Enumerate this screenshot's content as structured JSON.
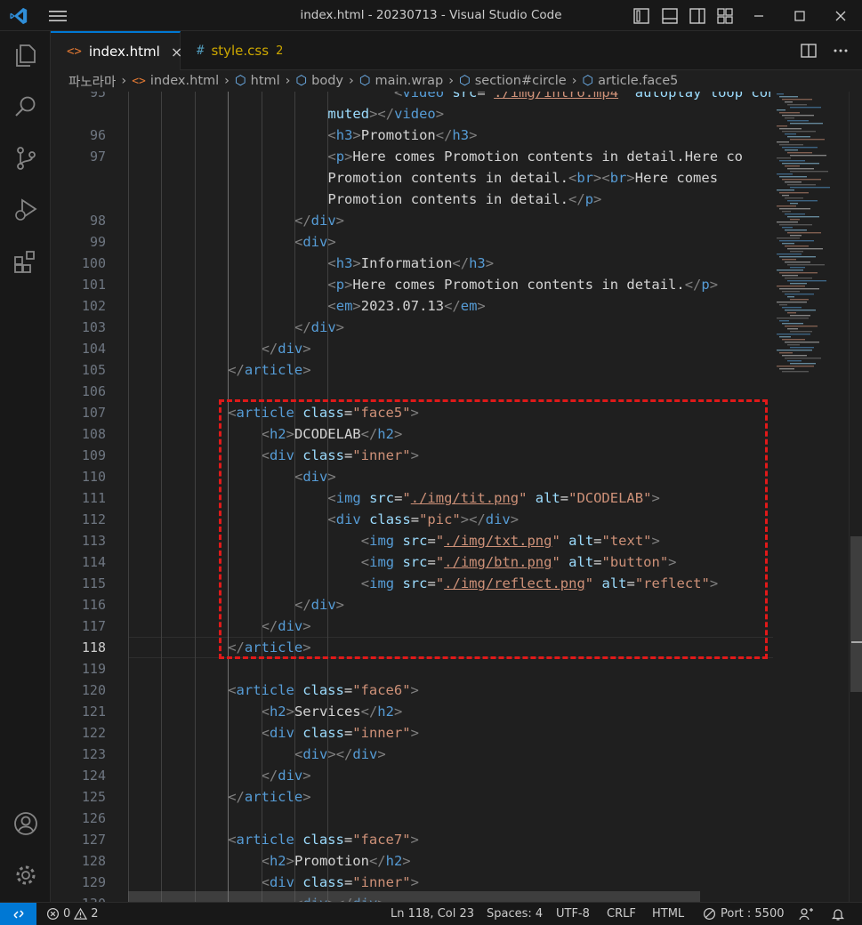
{
  "window": {
    "title": "index.html - 20230713 - Visual Studio Code"
  },
  "tabs": [
    {
      "label": "index.html",
      "icon": "<>",
      "active": true
    },
    {
      "label": "style.css",
      "icon": "#",
      "badge": "2",
      "active": false
    }
  ],
  "breadcrumb": [
    "파노라마",
    "index.html",
    "html",
    "body",
    "main.wrap",
    "section#circle",
    "article.face5"
  ],
  "editor": {
    "current_line": 118,
    "lines": [
      {
        "n": 95,
        "c": [
          [
            "",
            "        "
          ],
          [
            "p",
            "<"
          ],
          [
            "t",
            "video "
          ],
          [
            "a",
            "src"
          ],
          [
            "x",
            "="
          ],
          [
            "s",
            "\""
          ],
          [
            "u",
            "./img/intro.mp4"
          ],
          [
            "s",
            "\""
          ],
          [
            "x",
            " "
          ],
          [
            "a",
            "autoplay loop contro"
          ]
        ]
      },
      {
        "n": null,
        "c": [
          [
            "a",
            "muted"
          ],
          [
            "p",
            ">"
          ],
          [
            "p",
            "</"
          ],
          [
            "t",
            "video"
          ],
          [
            "p",
            ">"
          ]
        ]
      },
      {
        "n": 96,
        "c": [
          [
            "p",
            "<"
          ],
          [
            "t",
            "h3"
          ],
          [
            "p",
            ">"
          ],
          [
            "x",
            "Promotion"
          ],
          [
            "p",
            "</"
          ],
          [
            "t",
            "h3"
          ],
          [
            "p",
            ">"
          ]
        ]
      },
      {
        "n": 97,
        "c": [
          [
            "p",
            "<"
          ],
          [
            "t",
            "p"
          ],
          [
            "p",
            ">"
          ],
          [
            "x",
            "Here comes Promotion contents in detail.Here co"
          ]
        ]
      },
      {
        "n": null,
        "c": [
          [
            "x",
            "Promotion contents in detail."
          ],
          [
            "p",
            "<"
          ],
          [
            "t",
            "br"
          ],
          [
            "p",
            ">"
          ],
          [
            "p",
            "<"
          ],
          [
            "t",
            "br"
          ],
          [
            "p",
            ">"
          ],
          [
            "x",
            "Here comes"
          ]
        ]
      },
      {
        "n": null,
        "c": [
          [
            "x",
            "Promotion contents in detail."
          ],
          [
            "p",
            "</"
          ],
          [
            "t",
            "p"
          ],
          [
            "p",
            ">"
          ]
        ]
      },
      {
        "n": 98,
        "c": [
          [
            "p",
            "</"
          ],
          [
            "t",
            "div"
          ],
          [
            "p",
            ">"
          ]
        ]
      },
      {
        "n": 99,
        "c": [
          [
            "p",
            "<"
          ],
          [
            "t",
            "div"
          ],
          [
            "p",
            ">"
          ]
        ]
      },
      {
        "n": 100,
        "c": [
          [
            "p",
            "<"
          ],
          [
            "t",
            "h3"
          ],
          [
            "p",
            ">"
          ],
          [
            "x",
            "Information"
          ],
          [
            "p",
            "</"
          ],
          [
            "t",
            "h3"
          ],
          [
            "p",
            ">"
          ]
        ]
      },
      {
        "n": 101,
        "c": [
          [
            "p",
            "<"
          ],
          [
            "t",
            "p"
          ],
          [
            "p",
            ">"
          ],
          [
            "x",
            "Here comes Promotion contents in detail."
          ],
          [
            "p",
            "</"
          ],
          [
            "t",
            "p"
          ],
          [
            "p",
            ">"
          ]
        ]
      },
      {
        "n": 102,
        "c": [
          [
            "p",
            "<"
          ],
          [
            "t",
            "em"
          ],
          [
            "p",
            ">"
          ],
          [
            "x",
            "2023.07.13"
          ],
          [
            "p",
            "</"
          ],
          [
            "t",
            "em"
          ],
          [
            "p",
            ">"
          ]
        ]
      },
      {
        "n": 103,
        "c": [
          [
            "p",
            "</"
          ],
          [
            "t",
            "div"
          ],
          [
            "p",
            ">"
          ]
        ]
      },
      {
        "n": 104,
        "c": [
          [
            "p",
            "</"
          ],
          [
            "t",
            "div"
          ],
          [
            "p",
            ">"
          ]
        ]
      },
      {
        "n": 105,
        "c": [
          [
            "p",
            "</"
          ],
          [
            "t",
            "article"
          ],
          [
            "p",
            ">"
          ]
        ]
      },
      {
        "n": 106,
        "c": []
      },
      {
        "n": 107,
        "c": [
          [
            "p",
            "<"
          ],
          [
            "t",
            "article "
          ],
          [
            "a",
            "class"
          ],
          [
            "x",
            "="
          ],
          [
            "s",
            "\"face5\""
          ],
          [
            "p",
            ">"
          ]
        ]
      },
      {
        "n": 108,
        "c": [
          [
            "p",
            "<"
          ],
          [
            "t",
            "h2"
          ],
          [
            "p",
            ">"
          ],
          [
            "x",
            "DCODELAB"
          ],
          [
            "p",
            "</"
          ],
          [
            "t",
            "h2"
          ],
          [
            "p",
            ">"
          ]
        ]
      },
      {
        "n": 109,
        "c": [
          [
            "p",
            "<"
          ],
          [
            "t",
            "div "
          ],
          [
            "a",
            "class"
          ],
          [
            "x",
            "="
          ],
          [
            "s",
            "\"inner\""
          ],
          [
            "p",
            ">"
          ]
        ]
      },
      {
        "n": 110,
        "c": [
          [
            "p",
            "<"
          ],
          [
            "t",
            "div"
          ],
          [
            "p",
            ">"
          ]
        ]
      },
      {
        "n": 111,
        "c": [
          [
            "p",
            "<"
          ],
          [
            "t",
            "img "
          ],
          [
            "a",
            "src"
          ],
          [
            "x",
            "="
          ],
          [
            "s",
            "\""
          ],
          [
            "u",
            "./img/tit.png"
          ],
          [
            "s",
            "\""
          ],
          [
            "x",
            " "
          ],
          [
            "a",
            "alt"
          ],
          [
            "x",
            "="
          ],
          [
            "s",
            "\"DCODELAB\""
          ],
          [
            "p",
            ">"
          ]
        ]
      },
      {
        "n": 112,
        "c": [
          [
            "p",
            "<"
          ],
          [
            "t",
            "div "
          ],
          [
            "a",
            "class"
          ],
          [
            "x",
            "="
          ],
          [
            "s",
            "\"pic\""
          ],
          [
            "p",
            ">"
          ],
          [
            "p",
            "</"
          ],
          [
            "t",
            "div"
          ],
          [
            "p",
            ">"
          ]
        ]
      },
      {
        "n": 113,
        "c": [
          [
            "p",
            "<"
          ],
          [
            "t",
            "img "
          ],
          [
            "a",
            "src"
          ],
          [
            "x",
            "="
          ],
          [
            "s",
            "\""
          ],
          [
            "u",
            "./img/txt.png"
          ],
          [
            "s",
            "\""
          ],
          [
            "x",
            " "
          ],
          [
            "a",
            "alt"
          ],
          [
            "x",
            "="
          ],
          [
            "s",
            "\"text\""
          ],
          [
            "p",
            ">"
          ]
        ]
      },
      {
        "n": 114,
        "c": [
          [
            "p",
            "<"
          ],
          [
            "t",
            "img "
          ],
          [
            "a",
            "src"
          ],
          [
            "x",
            "="
          ],
          [
            "s",
            "\""
          ],
          [
            "u",
            "./img/btn.png"
          ],
          [
            "s",
            "\""
          ],
          [
            "x",
            " "
          ],
          [
            "a",
            "alt"
          ],
          [
            "x",
            "="
          ],
          [
            "s",
            "\"button\""
          ],
          [
            "p",
            ">"
          ]
        ]
      },
      {
        "n": 115,
        "c": [
          [
            "p",
            "<"
          ],
          [
            "t",
            "img "
          ],
          [
            "a",
            "src"
          ],
          [
            "x",
            "="
          ],
          [
            "s",
            "\""
          ],
          [
            "u",
            "./img/reflect.png"
          ],
          [
            "s",
            "\""
          ],
          [
            "x",
            " "
          ],
          [
            "a",
            "alt"
          ],
          [
            "x",
            "="
          ],
          [
            "s",
            "\"reflect\""
          ],
          [
            "p",
            ">"
          ]
        ]
      },
      {
        "n": 116,
        "c": [
          [
            "p",
            "</"
          ],
          [
            "t",
            "div"
          ],
          [
            "p",
            ">"
          ]
        ]
      },
      {
        "n": 117,
        "c": [
          [
            "p",
            "</"
          ],
          [
            "t",
            "div"
          ],
          [
            "p",
            ">"
          ]
        ]
      },
      {
        "n": 118,
        "c": [
          [
            "p",
            "</"
          ],
          [
            "t",
            "article"
          ],
          [
            "p",
            ">"
          ]
        ]
      },
      {
        "n": 119,
        "c": []
      },
      {
        "n": 120,
        "c": [
          [
            "p",
            "<"
          ],
          [
            "t",
            "article "
          ],
          [
            "a",
            "class"
          ],
          [
            "x",
            "="
          ],
          [
            "s",
            "\"face6\""
          ],
          [
            "p",
            ">"
          ]
        ]
      },
      {
        "n": 121,
        "c": [
          [
            "p",
            "<"
          ],
          [
            "t",
            "h2"
          ],
          [
            "p",
            ">"
          ],
          [
            "x",
            "Services"
          ],
          [
            "p",
            "</"
          ],
          [
            "t",
            "h2"
          ],
          [
            "p",
            ">"
          ]
        ]
      },
      {
        "n": 122,
        "c": [
          [
            "p",
            "<"
          ],
          [
            "t",
            "div "
          ],
          [
            "a",
            "class"
          ],
          [
            "x",
            "="
          ],
          [
            "s",
            "\"inner\""
          ],
          [
            "p",
            ">"
          ]
        ]
      },
      {
        "n": 123,
        "c": [
          [
            "p",
            "<"
          ],
          [
            "t",
            "div"
          ],
          [
            "p",
            ">"
          ],
          [
            "p",
            "</"
          ],
          [
            "t",
            "div"
          ],
          [
            "p",
            ">"
          ]
        ]
      },
      {
        "n": 124,
        "c": [
          [
            "p",
            "</"
          ],
          [
            "t",
            "div"
          ],
          [
            "p",
            ">"
          ]
        ]
      },
      {
        "n": 125,
        "c": [
          [
            "p",
            "</"
          ],
          [
            "t",
            "article"
          ],
          [
            "p",
            ">"
          ]
        ]
      },
      {
        "n": 126,
        "c": []
      },
      {
        "n": 127,
        "c": [
          [
            "p",
            "<"
          ],
          [
            "t",
            "article "
          ],
          [
            "a",
            "class"
          ],
          [
            "x",
            "="
          ],
          [
            "s",
            "\"face7\""
          ],
          [
            "p",
            ">"
          ]
        ]
      },
      {
        "n": 128,
        "c": [
          [
            "p",
            "<"
          ],
          [
            "t",
            "h2"
          ],
          [
            "p",
            ">"
          ],
          [
            "x",
            "Promotion"
          ],
          [
            "p",
            "</"
          ],
          [
            "t",
            "h2"
          ],
          [
            "p",
            ">"
          ]
        ]
      },
      {
        "n": 129,
        "c": [
          [
            "p",
            "<"
          ],
          [
            "t",
            "div "
          ],
          [
            "a",
            "class"
          ],
          [
            "x",
            "="
          ],
          [
            "s",
            "\"inner\""
          ],
          [
            "p",
            ">"
          ]
        ]
      },
      {
        "n": 130,
        "c": [
          [
            "p",
            "<"
          ],
          [
            "t",
            "div"
          ],
          [
            "p",
            ">"
          ],
          [
            "p",
            "</"
          ],
          [
            "t",
            "div"
          ],
          [
            "p",
            ">"
          ]
        ]
      }
    ]
  },
  "status": {
    "errors": "0",
    "warnings": "2",
    "position": "Ln 118, Col 23",
    "spaces": "Spaces: 4",
    "encoding": "UTF-8",
    "eol": "CRLF",
    "language": "HTML",
    "port": "Port : 5500"
  },
  "colors": {
    "accent": "#0078d4",
    "highlight": "#e01919"
  }
}
